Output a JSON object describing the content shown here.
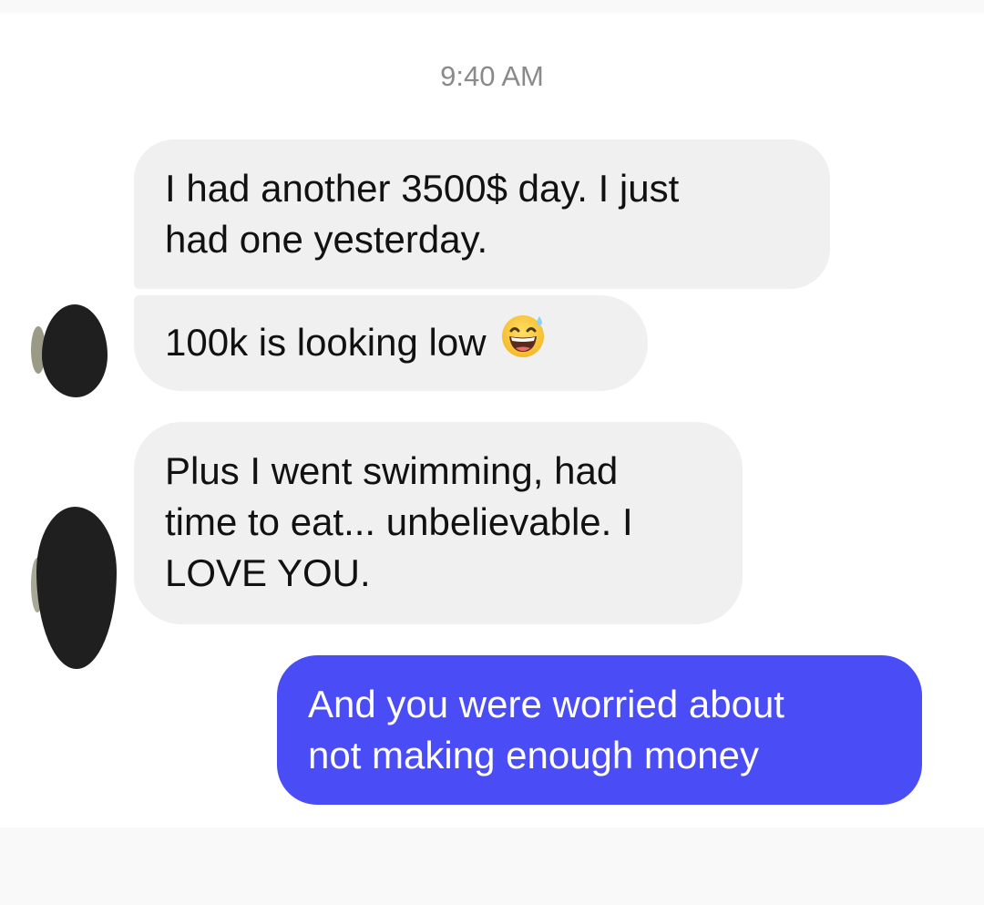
{
  "conversation": {
    "timestamp": "9:40 AM",
    "messages": [
      {
        "direction": "incoming",
        "lines": [
          "I had another 3500$ day. I just",
          "had one yesterday."
        ]
      },
      {
        "direction": "incoming",
        "text": "100k is looking low",
        "emoji": "grinning-face-with-sweat"
      },
      {
        "direction": "incoming",
        "lines": [
          "Plus I went swimming, had",
          "time to eat... unbelievable. I",
          "LOVE YOU."
        ]
      },
      {
        "direction": "outgoing",
        "lines": [
          "And you were worried about",
          "not making enough money"
        ]
      }
    ]
  },
  "colors": {
    "incoming_bubble": "#f0f0f0",
    "outgoing_bubble": "#4a4cf5",
    "timestamp_text": "#8a8a8a"
  }
}
